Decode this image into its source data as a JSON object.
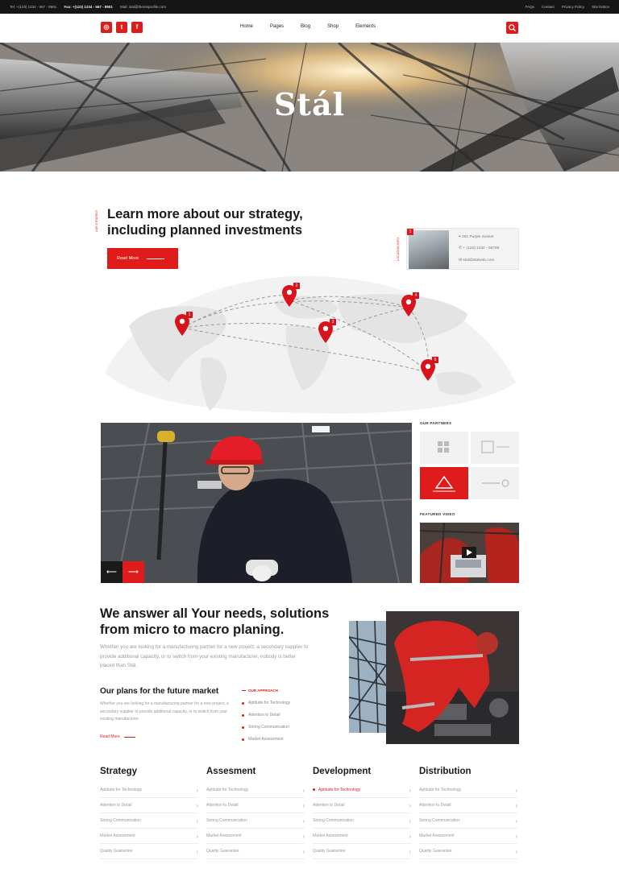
{
  "topbar": {
    "tel": "Tel: +(123) 1234 - 567 - 8901",
    "fax": "Fax: +(123) 1234 - 567 - 8901",
    "mail": "Mail: stal@themeprofile.com",
    "links": [
      "FAQs",
      "Contact",
      "Privacy Policy",
      "Site Notice"
    ]
  },
  "header": {
    "social": [
      "instagram-icon",
      "twitter-icon",
      "facebook-icon"
    ],
    "social_glyphs": [
      "◎",
      "t",
      "f"
    ],
    "nav": [
      "Home",
      "Pages",
      "Blog",
      "Shop",
      "Elements"
    ]
  },
  "hero": {
    "title": "Stál"
  },
  "strategy": {
    "label": "OUR STRATEGY",
    "title_line1": "Learn more about our strategy,",
    "title_line2": "including planned investments",
    "button": "Read More"
  },
  "location": {
    "label": "LOCATION INFO",
    "number": "1",
    "address": "251 Purple Sunset",
    "phone": "+ (123) 1234 - 56789",
    "email": "stal@stalweb.com"
  },
  "map": {
    "pins": [
      "1",
      "2",
      "3",
      "4",
      "5"
    ]
  },
  "partners": {
    "title": "OUR PARTNERS"
  },
  "featured": {
    "title": "FEATURED VIDEO"
  },
  "answer": {
    "title_line1": "We answer all Your needs, solutions",
    "title_line2": "from micro to macro planing.",
    "paragraph": "Whether you are looking for a manufacturing partner for a new project, a secondary supplier to provide additional capacity, or to switch from your existing manufacturer, nobody is better placed than Stál."
  },
  "plans": {
    "title": "Our plans for the future market",
    "paragraph": "Whether you are looking for a manufacturing partner for a new project, a secondary supplier to provide additional capacity, or to switch from your existing manufacturer.",
    "read_more": "Read More"
  },
  "approach": {
    "title": "OUR APPROACH",
    "items": [
      "Aptitude for Technology",
      "Attention to Detail",
      "Strong Communication",
      "Market Assessment"
    ]
  },
  "columns": [
    {
      "title": "Strategy",
      "items": [
        "Aptitude for Technology",
        "Attention to Detail",
        "Strong Communication",
        "Market Assessment",
        "Quality Guarantee"
      ]
    },
    {
      "title": "Assesment",
      "items": [
        "Aptitude for Technology",
        "Attention to Detail",
        "Strong Communication",
        "Market Assessment",
        "Quality Guarantee"
      ]
    },
    {
      "title": "Development",
      "items": [
        "Aptitude for Technology",
        "Attention to Detail",
        "Strong Communication",
        "Market Assessment",
        "Quality Guarantee"
      ]
    },
    {
      "title": "Distribution",
      "items": [
        "Aptitude for Technology",
        "Attention to Detail",
        "Strong Communication",
        "Market Assessment",
        "Quality Guarantee"
      ]
    }
  ],
  "colors": {
    "accent": "#e01b1b",
    "dark": "#151515"
  }
}
